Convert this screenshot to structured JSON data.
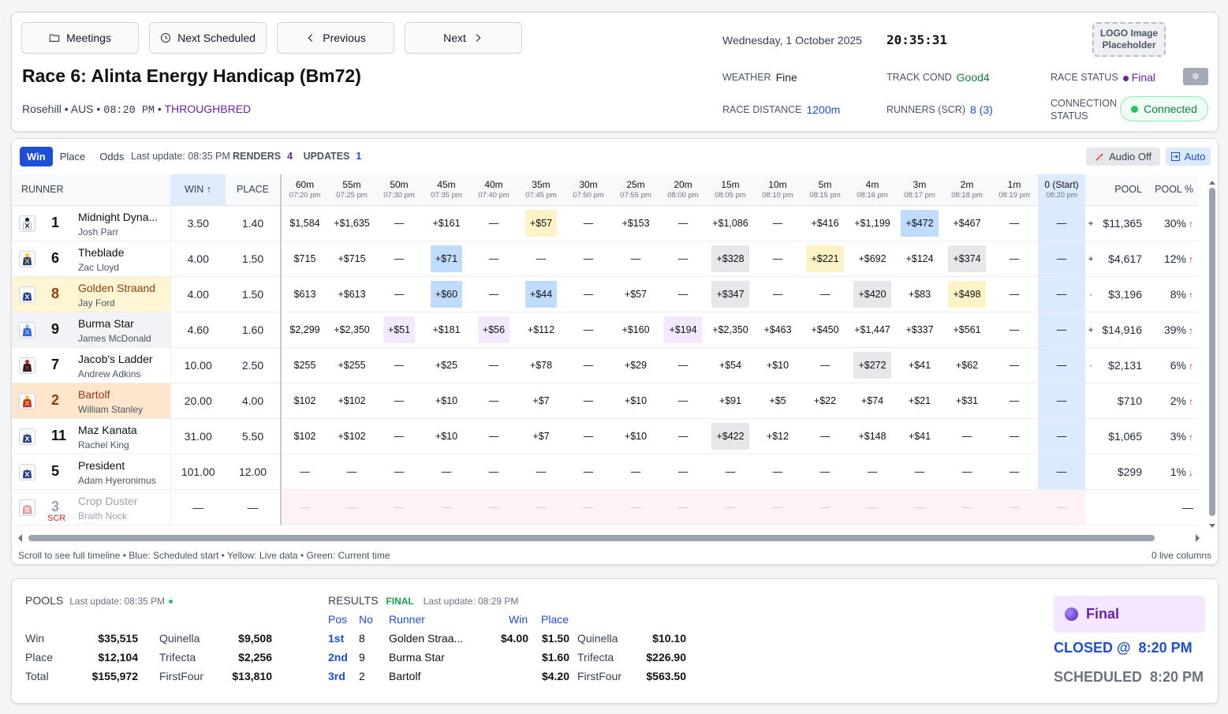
{
  "nav": {
    "meetings": "Meetings",
    "next_scheduled": "Next Scheduled",
    "previous": "Previous",
    "next": "Next"
  },
  "race": {
    "title": "Race 6: Alinta Energy Handicap (Bm72)",
    "venue": "Rosehill",
    "country": "AUS",
    "time": "08:20 PM",
    "type": "THROUGHBRED"
  },
  "header": {
    "date": "Wednesday, 1 October 2025",
    "clock": "20:35:31",
    "logo": "LOGO Image Placeholder",
    "weather_label": "WEATHER",
    "weather": "Fine",
    "track_label": "TRACK COND",
    "track": "Good4",
    "status_label": "RACE STATUS",
    "status": "Final",
    "distance_label": "RACE DISTANCE",
    "distance": "1200m",
    "runners_label": "RUNNERS (SCR)",
    "runners": "8 (3)",
    "connection_label": "CONNECTION STATUS",
    "connection": "Connected"
  },
  "toolbar": {
    "tabs": [
      "Win",
      "Place",
      "Odds"
    ],
    "active_tab": "Win",
    "last_update": "Last update: 08:35 PM",
    "renders_label": "RENDERS",
    "renders": "4",
    "updates_label": "UPDATES",
    "updates": "1",
    "audio": "Audio Off",
    "auto": "Auto"
  },
  "columns": {
    "runner": "RUNNER",
    "win": "WIN ↑",
    "place": "PLACE",
    "pool": "POOL",
    "pool_pct": "POOL %",
    "timeline": [
      {
        "t": "60m",
        "s": "07:20 pm"
      },
      {
        "t": "55m",
        "s": "07:25 pm"
      },
      {
        "t": "50m",
        "s": "07:30 pm"
      },
      {
        "t": "45m",
        "s": "07:35 pm"
      },
      {
        "t": "40m",
        "s": "07:40 pm"
      },
      {
        "t": "35m",
        "s": "07:45 pm"
      },
      {
        "t": "30m",
        "s": "07:50 pm"
      },
      {
        "t": "25m",
        "s": "07:55 pm"
      },
      {
        "t": "20m",
        "s": "08:00 pm"
      },
      {
        "t": "15m",
        "s": "08:05 pm"
      },
      {
        "t": "10m",
        "s": "08:10 pm"
      },
      {
        "t": "5m",
        "s": "08:15 pm"
      },
      {
        "t": "4m",
        "s": "08:16 pm"
      },
      {
        "t": "3m",
        "s": "08:17 pm"
      },
      {
        "t": "2m",
        "s": "08:18 pm"
      },
      {
        "t": "1m",
        "s": "08:19 pm"
      },
      {
        "t": "0 (Start)",
        "s": "08:20 pm"
      }
    ]
  },
  "runners": [
    {
      "no": "1",
      "name": "Midnight Dyna...",
      "jockey": "Josh Parr",
      "win": "3.50",
      "place": "1.40",
      "pool": "$11,365",
      "pct": "30%",
      "trend": "↑",
      "trend_dir": "up",
      "flag": "+",
      "style": "",
      "silk": [
        "#ffffff",
        "#1f2937"
      ],
      "tl": [
        "$1,584",
        "+$1,635",
        "—",
        "+$161",
        "—",
        "+$57",
        "—",
        "+$153",
        "—",
        "+$1,086",
        "—",
        "+$416",
        "+$1,199",
        "+$472",
        "+$467",
        "—",
        "—"
      ],
      "hl": [
        "",
        "",
        "",
        "",
        "",
        "yellow",
        "",
        "",
        "",
        "",
        "",
        "",
        "",
        "blue",
        "",
        "",
        ""
      ]
    },
    {
      "no": "6",
      "name": "Theblade",
      "jockey": "Zac Lloyd",
      "win": "4.00",
      "place": "1.50",
      "pool": "$4,617",
      "pct": "12%",
      "trend": "↑",
      "trend_dir": "up",
      "flag": "+",
      "style": "",
      "silk": [
        "#1e3a8a",
        "#facc15"
      ],
      "tl": [
        "$715",
        "+$715",
        "—",
        "+$71",
        "—",
        "—",
        "—",
        "—",
        "—",
        "+$328",
        "—",
        "+$221",
        "+$692",
        "+$124",
        "+$374",
        "—",
        "—"
      ],
      "hl": [
        "",
        "",
        "",
        "blue",
        "",
        "",
        "",
        "",
        "",
        "gray",
        "",
        "yellow",
        "",
        "",
        "gray",
        "",
        ""
      ]
    },
    {
      "no": "8",
      "name": "Golden Straand",
      "jockey": "Jay Ford",
      "win": "4.00",
      "place": "1.50",
      "pool": "$3,196",
      "pct": "8%",
      "trend": "↑",
      "trend_dir": "up",
      "flag": "·",
      "style": "fav",
      "silk": [
        "#1e3a8a",
        "#ffffff"
      ],
      "tl": [
        "$613",
        "+$613",
        "—",
        "+$60",
        "—",
        "+$44",
        "—",
        "+$57",
        "—",
        "+$347",
        "—",
        "—",
        "+$420",
        "+$83",
        "+$498",
        "—",
        "—"
      ],
      "hl": [
        "",
        "",
        "",
        "blue",
        "",
        "blue",
        "",
        "",
        "",
        "gray",
        "",
        "",
        "gray",
        "",
        "yellow",
        "",
        ""
      ]
    },
    {
      "no": "9",
      "name": "Burma Star",
      "jockey": "James McDonald",
      "win": "4.60",
      "place": "1.60",
      "pool": "$14,916",
      "pct": "39%",
      "trend": "↑",
      "trend_dir": "up",
      "flag": "+",
      "style": "alt",
      "silk": [
        "#2563eb",
        "#93c5fd"
      ],
      "tl": [
        "$2,299",
        "+$2,350",
        "+$51",
        "+$181",
        "+$56",
        "+$112",
        "—",
        "+$160",
        "+$194",
        "+$2,350",
        "+$463",
        "+$450",
        "+$1,447",
        "+$337",
        "+$561",
        "—",
        "—"
      ],
      "hl": [
        "",
        "",
        "purple",
        "",
        "purple",
        "",
        "",
        "",
        "purple",
        "",
        "",
        "",
        "",
        "",
        "",
        "",
        ""
      ]
    },
    {
      "no": "7",
      "name": "Jacob's Ladder",
      "jockey": "Andrew Adkins",
      "win": "10.00",
      "place": "2.50",
      "pool": "$2,131",
      "pct": "6%",
      "trend": "↑",
      "trend_dir": "up",
      "flag": "·",
      "style": "",
      "silk": [
        "#111827",
        "#dc2626"
      ],
      "tl": [
        "$255",
        "+$255",
        "—",
        "+$25",
        "—",
        "+$78",
        "—",
        "+$29",
        "—",
        "+$54",
        "+$10",
        "—",
        "+$272",
        "+$41",
        "+$62",
        "—",
        "—"
      ],
      "hl": [
        "",
        "",
        "",
        "",
        "",
        "",
        "",
        "",
        "",
        "",
        "",
        "",
        "gray",
        "",
        "",
        "",
        ""
      ]
    },
    {
      "no": "2",
      "name": "Bartolf",
      "jockey": "William Stanley",
      "win": "20.00",
      "place": "4.00",
      "pool": "$710",
      "pct": "2%",
      "trend": "↑",
      "trend_dir": "up",
      "flag": "",
      "style": "fav2",
      "silk": [
        "#dc2626",
        "#facc15"
      ],
      "tl": [
        "$102",
        "+$102",
        "—",
        "+$10",
        "—",
        "+$7",
        "—",
        "+$10",
        "—",
        "+$91",
        "+$5",
        "+$22",
        "+$74",
        "+$21",
        "+$31",
        "—",
        "—"
      ],
      "hl": [
        "",
        "",
        "",
        "",
        "",
        "",
        "",
        "",
        "",
        "",
        "",
        "",
        "",
        "",
        "",
        "",
        ""
      ]
    },
    {
      "no": "11",
      "name": "Maz Kanata",
      "jockey": "Rachel King",
      "win": "31.00",
      "place": "5.50",
      "pool": "$1,065",
      "pct": "3%",
      "trend": "↑",
      "trend_dir": "up",
      "flag": "",
      "style": "",
      "silk": [
        "#1e3a8a",
        "#ffffff"
      ],
      "tl": [
        "$102",
        "+$102",
        "—",
        "+$10",
        "—",
        "+$7",
        "—",
        "+$10",
        "—",
        "+$422",
        "+$12",
        "—",
        "+$148",
        "+$41",
        "—",
        "—",
        "—"
      ],
      "hl": [
        "",
        "",
        "",
        "",
        "",
        "",
        "",
        "",
        "",
        "gray",
        "",
        "",
        "",
        "",
        "",
        "",
        ""
      ]
    },
    {
      "no": "5",
      "name": "President",
      "jockey": "Adam Hyeronimus",
      "win": "101.00",
      "place": "12.00",
      "pool": "$299",
      "pct": "1%",
      "trend": "↓",
      "trend_dir": "down",
      "flag": "",
      "style": "",
      "silk": [
        "#1e3a8a",
        "#ffffff"
      ],
      "tl": [
        "—",
        "—",
        "—",
        "—",
        "—",
        "—",
        "—",
        "—",
        "—",
        "—",
        "—",
        "—",
        "—",
        "—",
        "—",
        "—",
        "—"
      ],
      "hl": [
        "",
        "",
        "",
        "",
        "",
        "",
        "",
        "",
        "",
        "",
        "",
        "",
        "",
        "",
        "",
        "",
        ""
      ]
    },
    {
      "no": "3",
      "name": "Crop Duster",
      "jockey": "Braith Nock",
      "scr": "SCR",
      "win": "—",
      "place": "—",
      "pool": "",
      "pct": "—",
      "trend": "",
      "trend_dir": "",
      "flag": "",
      "style": "scr",
      "silk": [
        "#fca5a5",
        "#ffffff"
      ],
      "tl": [
        "—",
        "—",
        "—",
        "—",
        "—",
        "—",
        "—",
        "—",
        "—",
        "—",
        "—",
        "—",
        "—",
        "—",
        "—",
        "—",
        "—"
      ],
      "hl": [
        "",
        "",
        "",
        "",
        "",
        "",
        "",
        "",
        "",
        "",
        "",
        "",
        "",
        "",
        "",
        "",
        ""
      ]
    }
  ],
  "grid_footer": {
    "legend": "Scroll to see full timeline • Blue: Scheduled start • Yellow: Live data • Green: Current time",
    "live_columns": "0 live columns"
  },
  "pools": {
    "label": "POOLS",
    "last_update": "Last update: 08:35 PM",
    "rows": [
      {
        "k": "Win",
        "v": "$35,515",
        "k2": "Quinella",
        "v2": "$9,508"
      },
      {
        "k": "Place",
        "v": "$12,104",
        "k2": "Trifecta",
        "v2": "$2,256"
      },
      {
        "k": "Total",
        "v": "$155,972",
        "k2": "FirstFour",
        "v2": "$13,810"
      }
    ]
  },
  "results": {
    "label": "RESULTS",
    "status": "FINAL",
    "last_update": "Last update: 08:29 PM",
    "headers": {
      "pos": "Pos",
      "no": "No",
      "runner": "Runner",
      "win": "Win",
      "place": "Place"
    },
    "rows": [
      {
        "pos": "1st",
        "no": "8",
        "runner": "Golden Straa...",
        "win": "$4.00",
        "place": "$1.50",
        "exotic": "Quinella",
        "exotic_val": "$10.10"
      },
      {
        "pos": "2nd",
        "no": "9",
        "runner": "Burma Star",
        "win": "",
        "place": "$1.60",
        "exotic": "Trifecta",
        "exotic_val": "$226.90"
      },
      {
        "pos": "3rd",
        "no": "2",
        "runner": "Bartolf",
        "win": "",
        "place": "$4.20",
        "exotic": "FirstFour",
        "exotic_val": "$563.50"
      }
    ]
  },
  "status_panel": {
    "final": "Final",
    "closed": "CLOSED @  8:20 PM",
    "scheduled": "SCHEDULED  8:20 PM"
  },
  "colors": {
    "accent": "#1d4ed8",
    "status_purple": "#6b21a8",
    "connected_green": "#15803d"
  }
}
